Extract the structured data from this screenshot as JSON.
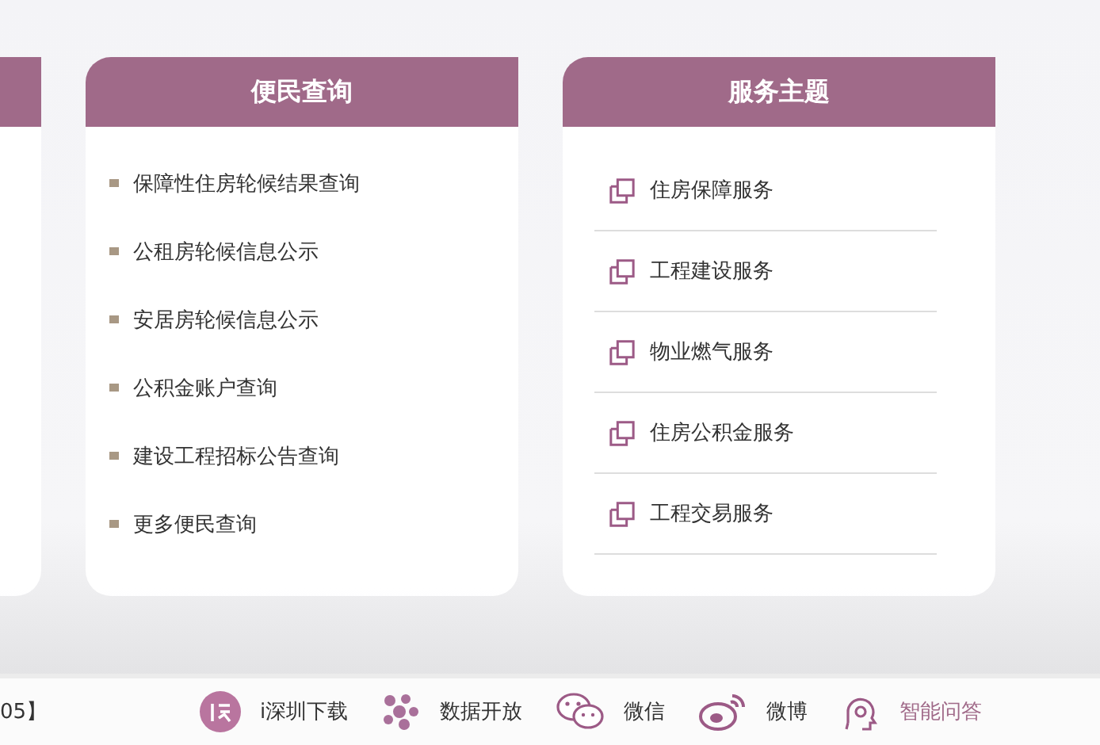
{
  "panels": [
    {
      "title": "便民查询",
      "kind": "bullets",
      "items": [
        {
          "label": "保障性住房轮候结果查询"
        },
        {
          "label": "公租房轮候信息公示"
        },
        {
          "label": "安居房轮候信息公示"
        },
        {
          "label": "公积金账户查询"
        },
        {
          "label": "建设工程招标公告查询"
        },
        {
          "label": "更多便民查询"
        }
      ]
    },
    {
      "title": "服务主题",
      "kind": "links",
      "items": [
        {
          "label": "住房保障服务"
        },
        {
          "label": "工程建设服务"
        },
        {
          "label": "物业燃气服务"
        },
        {
          "label": "住房公积金服务"
        },
        {
          "label": "工程交易服务"
        }
      ]
    }
  ],
  "footer": {
    "left_text": "05】",
    "links": [
      {
        "label": "i深圳下载",
        "kind": "app",
        "highlighted": false
      },
      {
        "label": "数据开放",
        "kind": "data",
        "highlighted": false
      },
      {
        "label": "微信",
        "kind": "wechat",
        "highlighted": false
      },
      {
        "label": "微博",
        "kind": "weibo",
        "highlighted": false
      },
      {
        "label": "智能问答",
        "kind": "assistant",
        "highlighted": true
      }
    ]
  }
}
